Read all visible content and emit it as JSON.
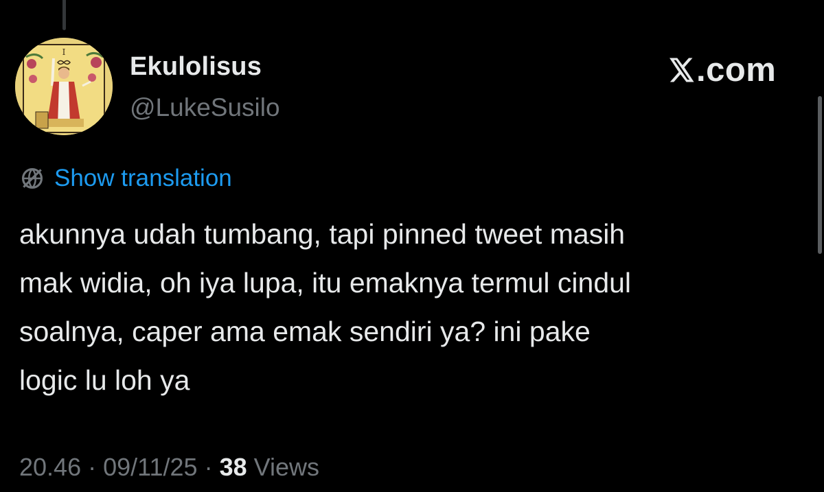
{
  "tweet": {
    "author": {
      "display_name": "Ekulolisus",
      "handle": "@LukeSusilo",
      "avatar_icon": "tarot-magician-avatar"
    },
    "brand": {
      "text": ".com",
      "icon": "x-logo-icon"
    },
    "translation": {
      "icon": "globe-icon",
      "label": "Show translation"
    },
    "text_lines": [
      "akunnya udah tumbang, tapi pinned tweet masih",
      "mak widia, oh iya lupa, itu emaknya termul cindul",
      "soalnya, caper ama emak sendiri ya? ini pake",
      "logic lu loh ya"
    ],
    "meta": {
      "time": "20.46",
      "separator": " · ",
      "date": "09/11/25",
      "views_count": "38",
      "views_label": "Views"
    }
  },
  "colors": {
    "background": "#000000",
    "text": "#e7e9ea",
    "secondary": "#71767b",
    "link": "#1d9bf0"
  }
}
